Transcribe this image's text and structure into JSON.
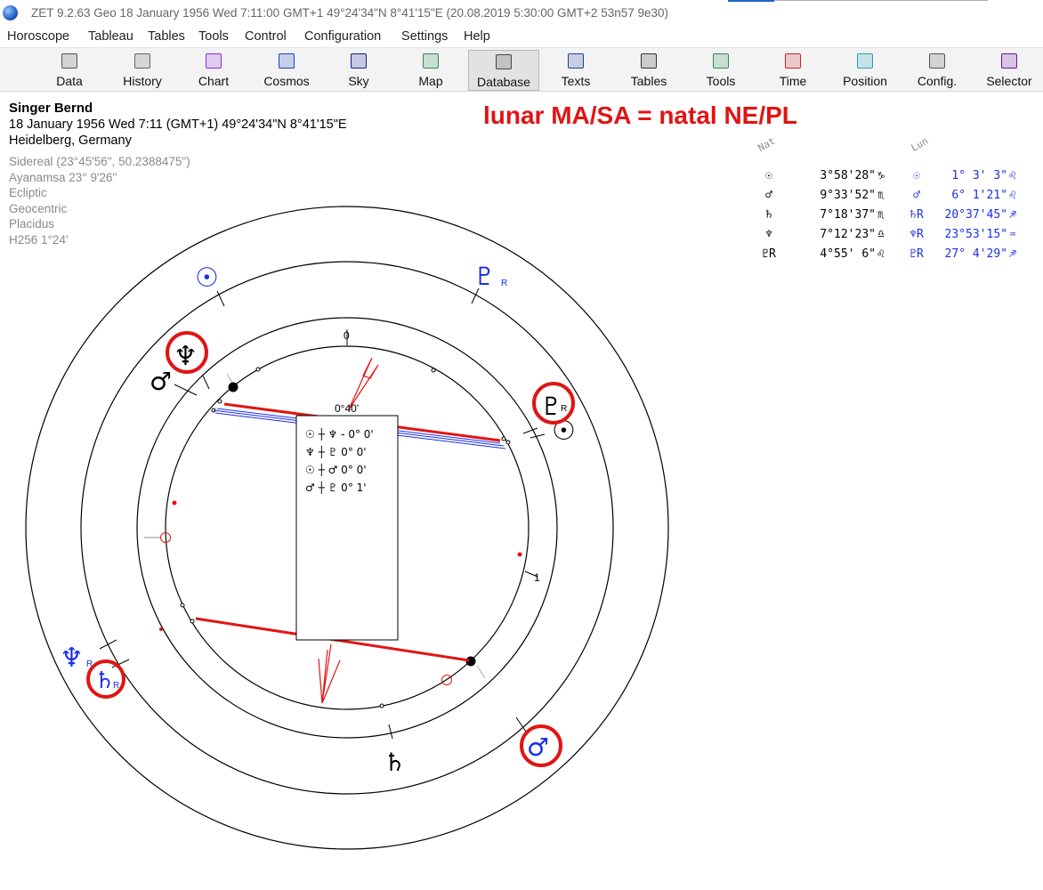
{
  "window": {
    "title": "ZET 9.2.63 Geo    18 January 1956  Wed    7:11:00 GMT+1 49°24'34\"N  8°41'15\"E  (20.08.2019    5:30:00 GMT+2 53n57 9e30)"
  },
  "menu": [
    "Horoscope",
    "Tableau",
    "Tables",
    "Tools",
    "Control",
    "Configuration",
    "Settings",
    "Help"
  ],
  "toolbar": [
    {
      "label": "Data",
      "icon": "grid-icon",
      "color": "#555555"
    },
    {
      "label": "History",
      "icon": "globe-icon",
      "color": "#666666"
    },
    {
      "label": "Chart",
      "icon": "wheel-icon",
      "color": "#8a2be2"
    },
    {
      "label": "Cosmos",
      "icon": "galaxy-icon",
      "color": "#1a3fbf"
    },
    {
      "label": "Sky",
      "icon": "stars-icon",
      "color": "#12208f"
    },
    {
      "label": "Map",
      "icon": "map-icon",
      "color": "#2e8b57"
    },
    {
      "label": "Database",
      "icon": "database-icon",
      "color": "#444444",
      "active": true
    },
    {
      "label": "Texts",
      "icon": "texts-icon",
      "color": "#1f3d99"
    },
    {
      "label": "Tables",
      "icon": "table-icon",
      "color": "#333333"
    },
    {
      "label": "Tools",
      "icon": "tools-icon",
      "color": "#2e8b57"
    },
    {
      "label": "Time",
      "icon": "time-icon",
      "color": "#cc2222"
    },
    {
      "label": "Position",
      "icon": "position-icon",
      "color": "#17a2b8"
    },
    {
      "label": "Config.",
      "icon": "config-icon",
      "color": "#555555"
    },
    {
      "label": "Selector",
      "icon": "selector-icon",
      "color": "#6a0dad"
    }
  ],
  "info": {
    "name": "Singer Bernd",
    "date_line": "18 January 1956  Wed    7:11  (GMT+1) 49°24'34\"N  8°41'15\"E",
    "place": "Heidelberg, Germany",
    "settings": [
      "Sidereal (23°45'56\", 50.2388475\")",
      "Ayanamsa 23° 9'26\"",
      "Ecliptic",
      "Geocentric",
      "Placidus",
      "H256   1°24'"
    ]
  },
  "headline": "lunar MA/SA = natal NE/PL",
  "positions": {
    "nat_label": "Nat",
    "lun_label": "Lun",
    "rows": [
      {
        "n_glyph": "☉",
        "n_val": "3°58'28\"",
        "n_sign": "♑",
        "l_glyph": "☉",
        "l_val": "1° 3' 3\"",
        "l_sign": "♌"
      },
      {
        "n_glyph": "♂",
        "n_val": "9°33'52\"",
        "n_sign": "♏",
        "l_glyph": "♂",
        "l_val": "6° 1'21\"",
        "l_sign": "♌"
      },
      {
        "n_glyph": "♄",
        "n_val": "7°18'37\"",
        "n_sign": "♏",
        "l_glyph": "♄R",
        "l_val": "20°37'45\"",
        "l_sign": "♐"
      },
      {
        "n_glyph": "♆",
        "n_val": "7°12'23\"",
        "n_sign": "♎",
        "l_glyph": "♆R",
        "l_val": "23°53'15\"",
        "l_sign": "♒"
      },
      {
        "n_glyph": "♇R",
        "n_val": "4°55' 6\"",
        "n_sign": "♌",
        "l_glyph": "♇R",
        "l_val": "27° 4'29\"",
        "l_sign": "♐"
      }
    ]
  },
  "wheel": {
    "cusp_labels": [
      "0",
      "1"
    ],
    "midpoint_box": {
      "title": "0°40'",
      "lines": [
        "☉ ┼ ♆ - 0° 0'",
        "♆ ┼ ♇    0° 0'",
        "☉ ┼ ♂    0° 0'",
        "♂ ┼ ♇    0° 1'"
      ]
    },
    "planets": [
      {
        "glyph": "☉",
        "ring": "outer"
      },
      {
        "glyph": "♇",
        "ring": "outer",
        "retro": "R"
      },
      {
        "glyph": "♆",
        "ring": "outer",
        "retro": "R"
      },
      {
        "glyph": "♄",
        "ring": "outer",
        "retro": "R"
      },
      {
        "glyph": "♂",
        "ring": "outer"
      },
      {
        "glyph": "♆",
        "ring": "inner"
      },
      {
        "glyph": "♂",
        "ring": "inner"
      },
      {
        "glyph": "♇",
        "ring": "inner",
        "retro": "R"
      },
      {
        "glyph": "☉",
        "ring": "inner"
      },
      {
        "glyph": "♄",
        "ring": "inner"
      }
    ],
    "colors": {
      "natal": "#000000",
      "lunar": "#1a2ee6",
      "highlight": "#e11414",
      "aspect_blue": "#1a2ee6"
    }
  }
}
